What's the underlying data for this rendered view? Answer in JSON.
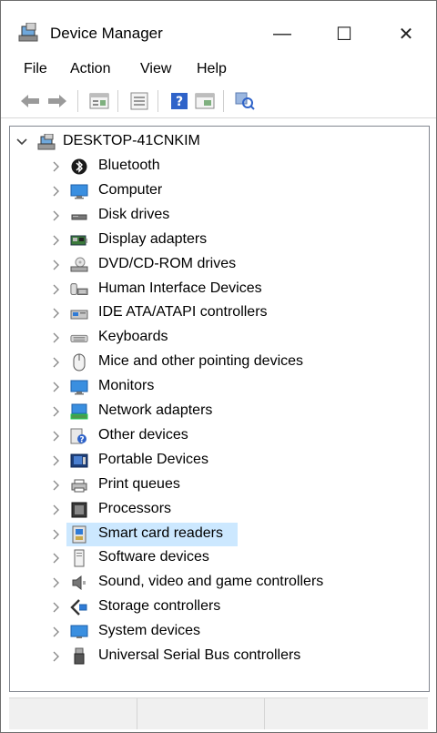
{
  "window": {
    "title": "Device Manager",
    "minimize_glyph": "—",
    "maximize_glyph": "☐",
    "close_glyph": "✕"
  },
  "menu": [
    "File",
    "Action",
    "View",
    "Help"
  ],
  "toolbar": {
    "buttons": [
      "back-arrow-icon",
      "forward-arrow-icon",
      "properties-icon",
      "update-driver-icon",
      "help-icon",
      "show-hidden-icon",
      "scan-hardware-icon"
    ]
  },
  "tree": {
    "root": {
      "label": "DESKTOP-41CNKIM",
      "expanded": true,
      "icon": "computer-root-icon"
    },
    "items": [
      {
        "label": "Bluetooth",
        "icon": "bluetooth-icon"
      },
      {
        "label": "Computer",
        "icon": "monitor-icon"
      },
      {
        "label": "Disk drives",
        "icon": "disk-drive-icon"
      },
      {
        "label": "Display adapters",
        "icon": "display-adapter-icon"
      },
      {
        "label": "DVD/CD-ROM drives",
        "icon": "dvd-drive-icon"
      },
      {
        "label": "Human Interface Devices",
        "icon": "hid-icon"
      },
      {
        "label": "IDE ATA/ATAPI controllers",
        "icon": "ide-controller-icon"
      },
      {
        "label": "Keyboards",
        "icon": "keyboard-icon"
      },
      {
        "label": "Mice and other pointing devices",
        "icon": "mouse-icon"
      },
      {
        "label": "Monitors",
        "icon": "monitor-icon"
      },
      {
        "label": "Network adapters",
        "icon": "network-adapter-icon"
      },
      {
        "label": "Other devices",
        "icon": "unknown-device-icon"
      },
      {
        "label": "Portable Devices",
        "icon": "portable-device-icon"
      },
      {
        "label": "Print queues",
        "icon": "printer-icon"
      },
      {
        "label": "Processors",
        "icon": "processor-icon"
      },
      {
        "label": "Smart card readers",
        "icon": "smart-card-reader-icon",
        "selected": true
      },
      {
        "label": "Software devices",
        "icon": "software-device-icon"
      },
      {
        "label": "Sound, video and game controllers",
        "icon": "speaker-icon"
      },
      {
        "label": "Storage controllers",
        "icon": "storage-controller-icon"
      },
      {
        "label": "System devices",
        "icon": "system-devices-icon"
      },
      {
        "label": "Universal Serial Bus controllers",
        "icon": "usb-icon"
      }
    ]
  },
  "colors": {
    "selection": "#cce8ff",
    "accent": "#1e7bd6"
  }
}
